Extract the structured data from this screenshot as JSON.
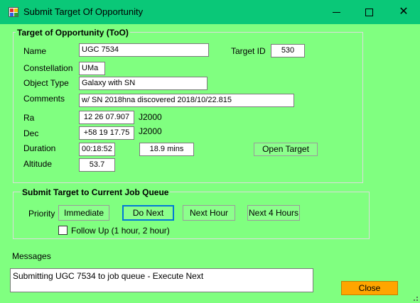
{
  "window": {
    "title": "Submit Target Of Opportunity",
    "icon": "app-icon",
    "controls": {
      "minimize_icon": "minimize-icon",
      "maximize_icon": "maximize-icon",
      "close_glyph": "✕"
    }
  },
  "too": {
    "group_title": "Target of Opportunity (ToO)",
    "name_label": "Name",
    "name_value": "UGC 7534",
    "target_id_label": "Target ID",
    "target_id_value": "530",
    "constellation_label": "Constellation",
    "constellation_value": "UMa",
    "object_type_label": "Object Type",
    "object_type_value": "Galaxy with SN",
    "comments_label": "Comments",
    "comments_value": "w/ SN 2018hna discovered 2018/10/22.815",
    "ra_label": "Ra",
    "ra_value": "12 26 07.907",
    "ra_epoch": "J2000",
    "dec_label": "Dec",
    "dec_value": "+58 19 17.75",
    "dec_epoch": "J2000",
    "duration_label": "Duration",
    "duration_value": "00:18:52",
    "duration_mins": "18.9 mins",
    "open_target_label": "Open Target",
    "altitude_label": "Altitude",
    "altitude_value": "53.7"
  },
  "queue": {
    "group_title": "Submit Target to Current Job Queue",
    "priority_label": "Priority",
    "buttons": {
      "immediate": "Immediate",
      "do_next": "Do Next",
      "next_hour": "Next Hour",
      "next_4_hours": "Next 4 Hours"
    },
    "follow_up_label": "Follow Up (1 hour, 2 hour)",
    "follow_up_checked": false
  },
  "messages": {
    "label": "Messages",
    "text": "Submitting UGC 7534 to job queue - Execute Next"
  },
  "close_label": "Close",
  "colors": {
    "background": "#80ff80",
    "titlebar": "#0ac878",
    "button": "#8cff8c",
    "close_button": "#ffa500",
    "focus_border": "#0078d7"
  }
}
